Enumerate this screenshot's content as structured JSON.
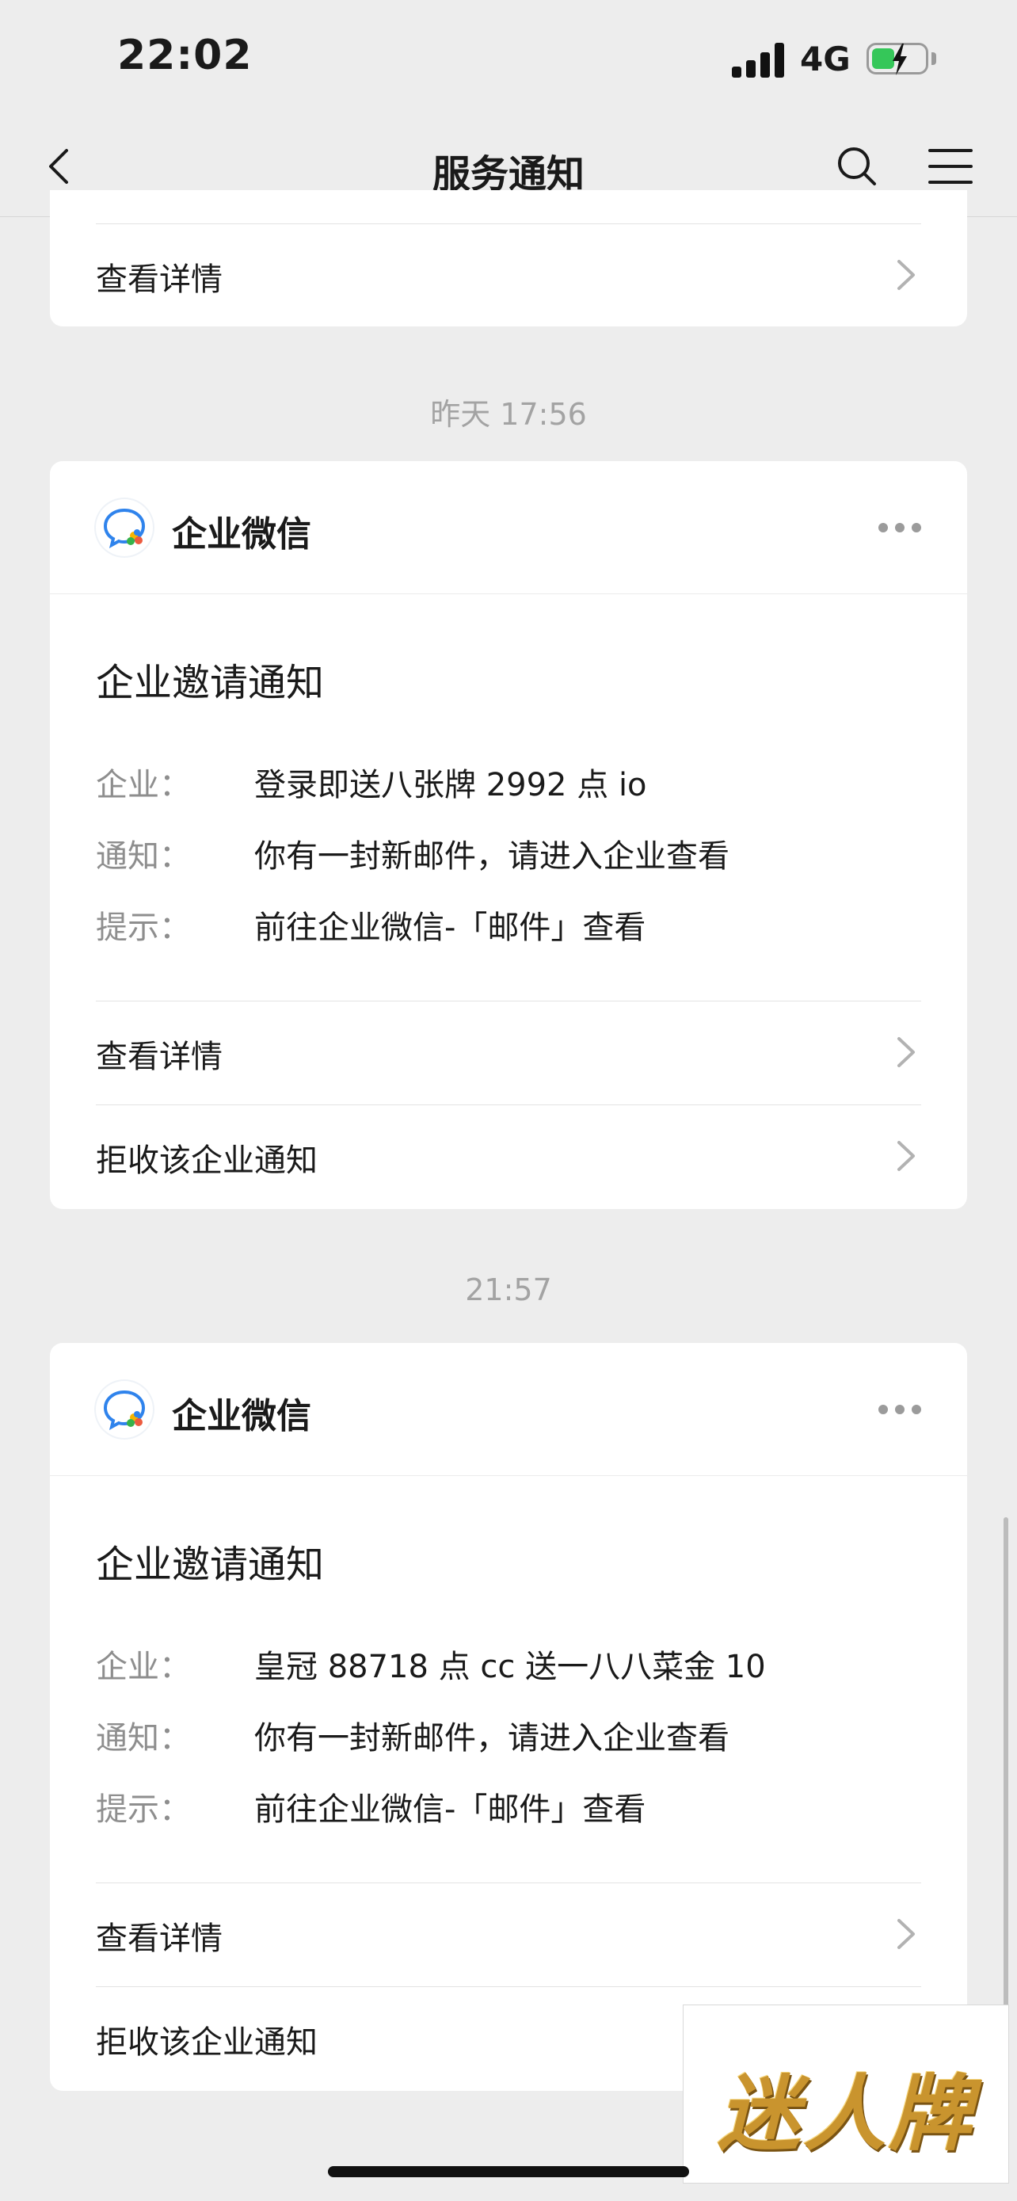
{
  "status_bar": {
    "time": "22:02",
    "network": "4G"
  },
  "nav": {
    "title": "服务通知"
  },
  "top_card": {
    "detail_label": "查看详情"
  },
  "messages": [
    {
      "timestamp": "昨天 17:56",
      "app_name": "企业微信",
      "title": "企业邀请通知",
      "fields": [
        {
          "key": "企业：",
          "value": "登录即送八张牌 2992 点 io"
        },
        {
          "key": "通知：",
          "value": "你有一封新邮件，请进入企业查看"
        },
        {
          "key": "提示：",
          "value": "前往企业微信-「邮件」查看"
        }
      ],
      "detail_label": "查看详情",
      "reject_label": "拒收该企业通知"
    },
    {
      "timestamp": "21:57",
      "app_name": "企业微信",
      "title": "企业邀请通知",
      "fields": [
        {
          "key": "企业：",
          "value": "皇冠 88718 点 cc 送一八八菜金 10"
        },
        {
          "key": "通知：",
          "value": "你有一封新邮件，请进入企业查看"
        },
        {
          "key": "提示：",
          "value": "前往企业微信-「邮件」查看"
        }
      ],
      "detail_label": "查看详情",
      "reject_label": "拒收该企业通知"
    }
  ],
  "watermark": {
    "text": "迷人牌"
  },
  "colors": {
    "background": "#ededed",
    "card": "#ffffff",
    "muted": "#8e8e8e",
    "battery": "#35c759"
  }
}
